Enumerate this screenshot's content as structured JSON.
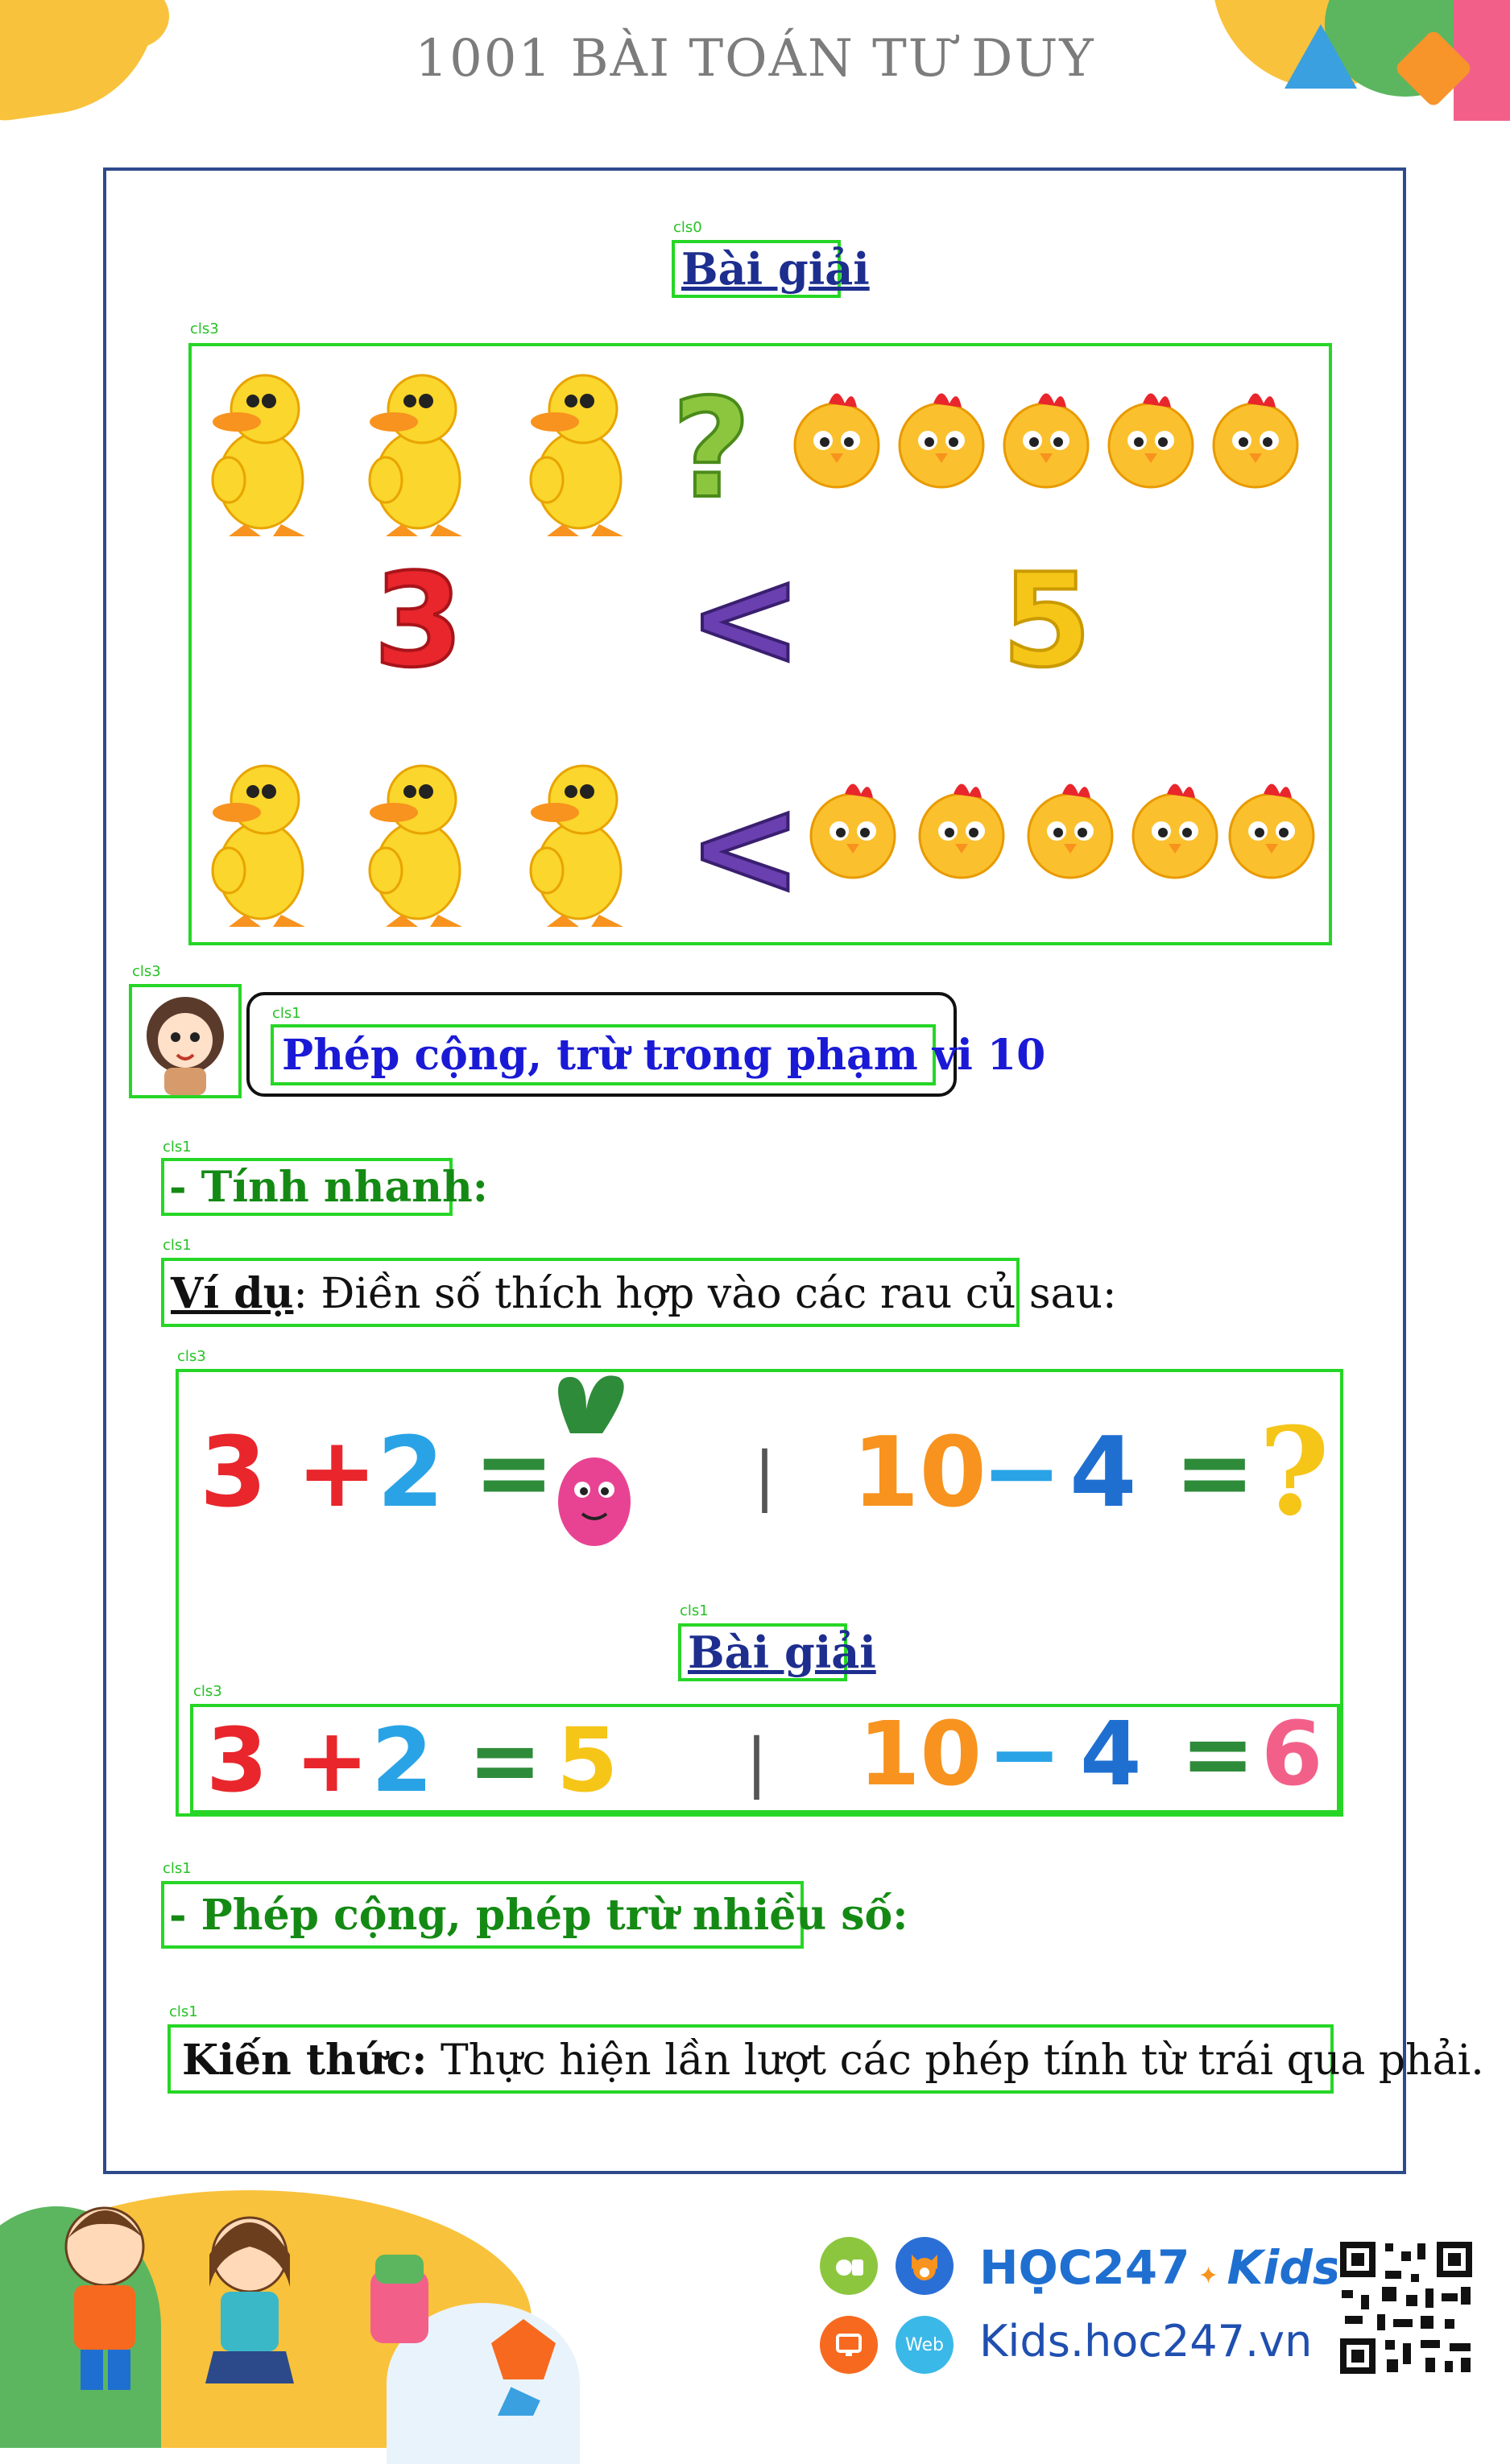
{
  "header": {
    "title": "1001 BÀI TOÁN TƯ DUY"
  },
  "tags": {
    "t0": "cls0",
    "t1": "cls3",
    "t2": "cls3",
    "t3": "cls1",
    "t4": "cls1",
    "t5": "cls1",
    "t6": "cls3",
    "t7": "cls1",
    "t8": "cls3",
    "t9": "cls1",
    "t10": "cls1"
  },
  "section1": {
    "title": "Bài giải",
    "compare": {
      "left": "3",
      "sign": "<",
      "right": "5",
      "question": "?"
    }
  },
  "topic": {
    "title": "Phép cộng, trừ trong phạm vi 10"
  },
  "quick": {
    "heading": "- Tính nhanh:",
    "example_label": "Ví dụ",
    "example_text": ": Điền số thích hợp vào các rau củ sau:",
    "eq1": {
      "a": "3",
      "op": "+",
      "b": "2",
      "eq": "="
    },
    "eq2": {
      "a": "10",
      "op": "−",
      "b": "4",
      "eq": "=",
      "q": "?"
    },
    "divider": "|",
    "solution_title": "Bài giải",
    "sol1": {
      "a": "3",
      "op": "+",
      "b": "2",
      "eq": "=",
      "r": "5"
    },
    "sol2": {
      "a": "10",
      "op": "−",
      "b": "4",
      "eq": "=",
      "r": "6"
    }
  },
  "multi": {
    "heading": "- Phép cộng, phép trừ nhiều số:",
    "knowledge_label": "Kiến thức:",
    "knowledge_text": " Thực hiện lần lượt các phép tính từ trái qua phải."
  },
  "footer": {
    "brand_main": "HỌC247",
    "brand_kids": "Kids",
    "website": "Kids.hoc247.vn",
    "web_icon_label": "Web"
  },
  "colors": {
    "green_box": "#26d626",
    "frame": "#2e4a8c",
    "title_blue": "#1d2e8f",
    "topic_blue": "#1a1ad6",
    "heading_green": "#148a14",
    "num_red": "#e8262c",
    "num_blue": "#2aa3e6",
    "num_yellow": "#f5c518",
    "num_orange": "#f7931e",
    "num_green": "#2e8b3a",
    "num_pink": "#f2608a",
    "sign_purple": "#6a3fb0"
  },
  "icons": [
    "duck-icon",
    "chick-icon",
    "question-mark-icon",
    "radish-icon",
    "girl-avatar-icon",
    "kids-illustration",
    "qr-code-icon",
    "android-apple-icon",
    "fox-mascot-icon",
    "monitor-icon",
    "web-icon"
  ]
}
